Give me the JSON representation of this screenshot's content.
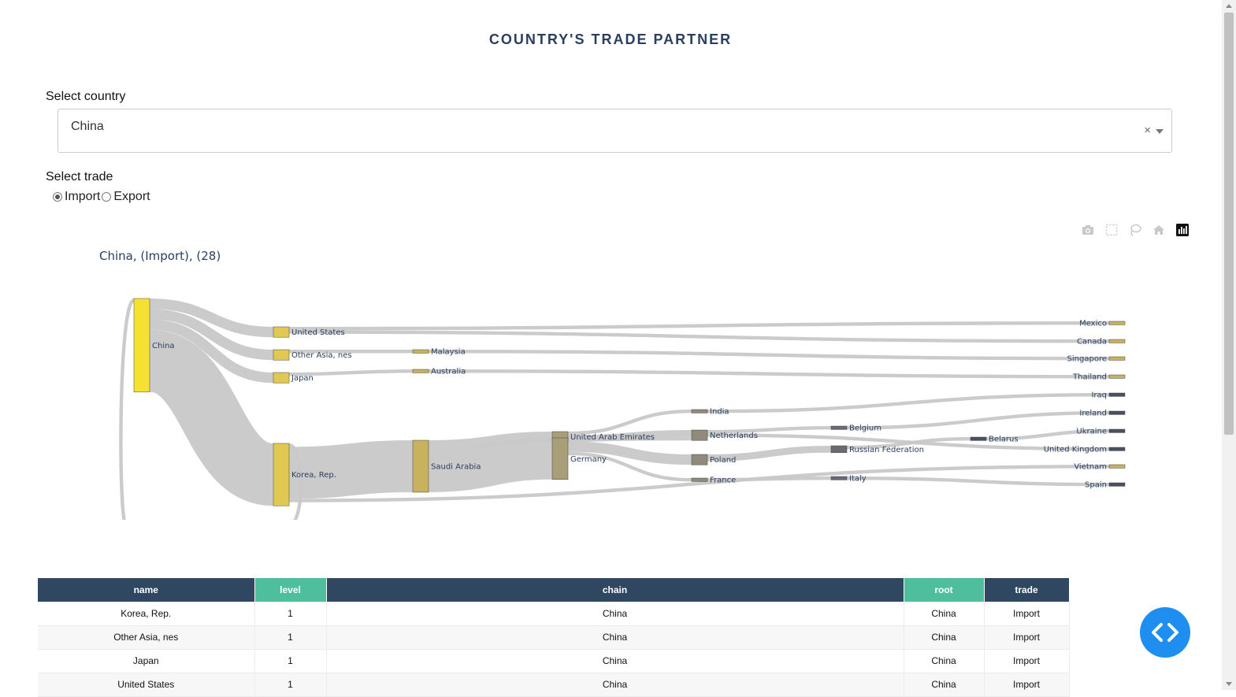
{
  "page": {
    "title": "COUNTRY'S TRADE PARTNER"
  },
  "country_select": {
    "label": "Select country",
    "value": "China",
    "clear_symbol": "×"
  },
  "trade_select": {
    "label": "Select trade",
    "options": [
      {
        "label": "Import",
        "selected": true
      },
      {
        "label": "Export",
        "selected": false
      }
    ]
  },
  "modebar": {
    "icons": [
      "camera-icon",
      "box-select-icon",
      "lasso-icon",
      "home-icon",
      "plotly-logo-icon"
    ]
  },
  "chart_data": {
    "type": "sankey",
    "title": "China, (Import), (28)",
    "colors": {
      "root": "#f5e131",
      "level1": "#e1c853",
      "level2": "#c9b25e",
      "level3": "#a89e78",
      "level4": "#8f8a7c",
      "level5": "#6b6a72",
      "level6": "#4a5060",
      "link": "#c8c8c8"
    },
    "nodes": [
      {
        "id": "china",
        "label": "China",
        "level": 0
      },
      {
        "id": "us",
        "label": "United States",
        "level": 1
      },
      {
        "id": "oan",
        "label": "Other Asia, nes",
        "level": 1
      },
      {
        "id": "japan",
        "label": "Japan",
        "level": 1
      },
      {
        "id": "korea",
        "label": "Korea, Rep.",
        "level": 1
      },
      {
        "id": "malaysia",
        "label": "Malaysia",
        "level": 2
      },
      {
        "id": "australia",
        "label": "Australia",
        "level": 2
      },
      {
        "id": "saudi",
        "label": "Saudi Arabia",
        "level": 2
      },
      {
        "id": "uae",
        "label": "United Arab Emirates",
        "level": 3
      },
      {
        "id": "germany",
        "label": "Germany",
        "level": 3
      },
      {
        "id": "india",
        "label": "India",
        "level": 4
      },
      {
        "id": "netherlands",
        "label": "Netherlands",
        "level": 4
      },
      {
        "id": "poland",
        "label": "Poland",
        "level": 4
      },
      {
        "id": "france",
        "label": "France",
        "level": 4
      },
      {
        "id": "belgium",
        "label": "Belgium",
        "level": 5
      },
      {
        "id": "russia",
        "label": "Russian Federation",
        "level": 5
      },
      {
        "id": "italy",
        "label": "Italy",
        "level": 5
      },
      {
        "id": "belarus",
        "label": "Belarus",
        "level": 6
      },
      {
        "id": "mexico",
        "label": "Mexico",
        "level": 7
      },
      {
        "id": "canada",
        "label": "Canada",
        "level": 7
      },
      {
        "id": "singapore",
        "label": "Singapore",
        "level": 7
      },
      {
        "id": "thailand",
        "label": "Thailand",
        "level": 7
      },
      {
        "id": "iraq",
        "label": "Iraq",
        "level": 7
      },
      {
        "id": "ireland",
        "label": "Ireland",
        "level": 7
      },
      {
        "id": "ukraine",
        "label": "Ukraine",
        "level": 7
      },
      {
        "id": "uk",
        "label": "United Kingdom",
        "level": 7
      },
      {
        "id": "vietnam",
        "label": "Vietnam",
        "level": 7
      },
      {
        "id": "spain",
        "label": "Spain",
        "level": 7
      }
    ],
    "links": [
      {
        "source": "china",
        "target": "us",
        "value": 3
      },
      {
        "source": "china",
        "target": "oan",
        "value": 3
      },
      {
        "source": "china",
        "target": "japan",
        "value": 3
      },
      {
        "source": "china",
        "target": "korea",
        "value": 18
      },
      {
        "source": "korea",
        "target": "china",
        "value": 1
      },
      {
        "source": "us",
        "target": "mexico",
        "value": 1
      },
      {
        "source": "us",
        "target": "canada",
        "value": 1
      },
      {
        "source": "oan",
        "target": "malaysia",
        "value": 1
      },
      {
        "source": "malaysia",
        "target": "singapore",
        "value": 1
      },
      {
        "source": "japan",
        "target": "australia",
        "value": 1
      },
      {
        "source": "australia",
        "target": "thailand",
        "value": 1
      },
      {
        "source": "korea",
        "target": "saudi",
        "value": 15
      },
      {
        "source": "korea",
        "target": "vietnam",
        "value": 1
      },
      {
        "source": "saudi",
        "target": "uae",
        "value": 3
      },
      {
        "source": "saudi",
        "target": "germany",
        "value": 12
      },
      {
        "source": "uae",
        "target": "india",
        "value": 1
      },
      {
        "source": "uae",
        "target": "netherlands",
        "value": 2
      },
      {
        "source": "india",
        "target": "iraq",
        "value": 1
      },
      {
        "source": "germany",
        "target": "netherlands",
        "value": 1
      },
      {
        "source": "germany",
        "target": "poland",
        "value": 3
      },
      {
        "source": "germany",
        "target": "france",
        "value": 1
      },
      {
        "source": "netherlands",
        "target": "belgium",
        "value": 1
      },
      {
        "source": "netherlands",
        "target": "uk",
        "value": 1
      },
      {
        "source": "poland",
        "target": "russia",
        "value": 2
      },
      {
        "source": "france",
        "target": "italy",
        "value": 1
      },
      {
        "source": "belgium",
        "target": "ireland",
        "value": 1
      },
      {
        "source": "russia",
        "target": "belarus",
        "value": 1
      },
      {
        "source": "belarus",
        "target": "ukraine",
        "value": 1
      },
      {
        "source": "italy",
        "target": "spain",
        "value": 1
      }
    ]
  },
  "table": {
    "columns": [
      "name",
      "level",
      "chain",
      "root",
      "trade"
    ],
    "rows": [
      [
        "Korea, Rep.",
        "1",
        "China",
        "China",
        "Import"
      ],
      [
        "Other Asia, nes",
        "1",
        "China",
        "China",
        "Import"
      ],
      [
        "Japan",
        "1",
        "China",
        "China",
        "Import"
      ],
      [
        "United States",
        "1",
        "China",
        "China",
        "Import"
      ]
    ]
  },
  "fab": {
    "icon": "code-icon"
  }
}
